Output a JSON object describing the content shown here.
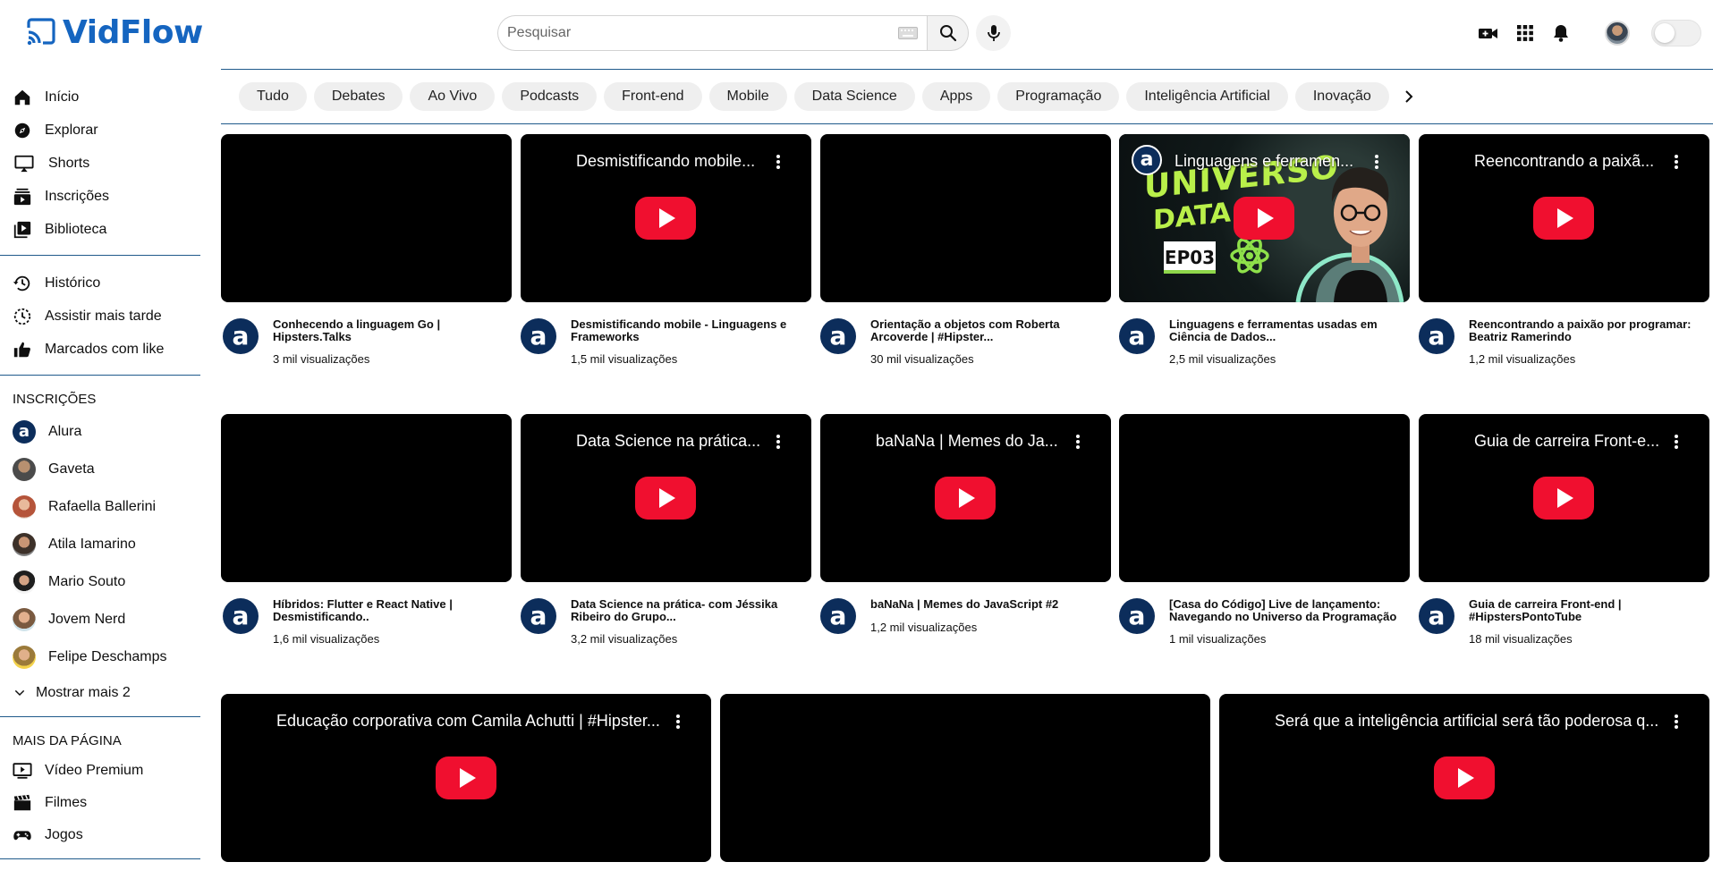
{
  "app": {
    "name": "VidFlow"
  },
  "search": {
    "placeholder": "Pesquisar"
  },
  "sidebar": {
    "main": [
      "Início",
      "Explorar",
      "Shorts",
      "Inscrições",
      "Biblioteca"
    ],
    "secondary": [
      "Histórico",
      "Assistir mais tarde",
      "Marcados com like"
    ],
    "subscriptions_title": "INSCRIÇÕES",
    "subscriptions": [
      "Alura",
      "Gaveta",
      "Rafaella Ballerini",
      "Atila Iamarino",
      "Mario Souto",
      "Jovem Nerd",
      "Felipe Deschamps"
    ],
    "show_more": "Mostrar mais 2",
    "more_title": "MAIS DA PÁGINA",
    "more": [
      "Vídeo Premium",
      "Filmes",
      "Jogos"
    ]
  },
  "chips": [
    "Tudo",
    "Debates",
    "Ao Vivo",
    "Podcasts",
    "Front-end",
    "Mobile",
    "Data Science",
    "Apps",
    "Programação",
    "Inteligência Artificial",
    "Inovação"
  ],
  "videos": [
    {
      "overlay_title": "",
      "title": "Conhecendo a linguagem Go | Hipsters.Talks",
      "views": "3 mil visualizações"
    },
    {
      "overlay_title": "Desmistificando mobile...",
      "title": "Desmistificando mobile - Linguagens e Frameworks",
      "views": "1,5 mil visualizações"
    },
    {
      "overlay_title": "",
      "title": "Orientação a objetos com Roberta Arcoverde | #Hipster...",
      "views": "30 mil visualizações"
    },
    {
      "overlay_title": "Linguagens e ferramen...",
      "title": "Linguagens e ferramentas usadas em Ciência de Dados...",
      "views": "2,5 mil visualizações",
      "thumb_text": [
        "UNIVERSO",
        "DATA SC",
        "EP03"
      ]
    },
    {
      "overlay_title": "Reencontrando a paixã...",
      "title": "Reencontrando a paixão por programar: Beatriz Ramerindo",
      "views": "1,2 mil visualizações"
    },
    {
      "overlay_title": "",
      "title": "Híbridos: Flutter e React Native | Desmistificando..",
      "views": "1,6 mil visualizações"
    },
    {
      "overlay_title": "Data Science na prática...",
      "title": "Data Science na prática- com Jéssika Ribeiro do Grupo...",
      "views": "3,2 mil visualizações"
    },
    {
      "overlay_title": "baNaNa | Memes do Ja...",
      "title": "baNaNa | Memes do JavaScript #2",
      "views": "1,2 mil visualizações"
    },
    {
      "overlay_title": "",
      "title": "[Casa do Código] Live de lançamento: Navegando no Universo da Programação",
      "views": "1 mil visualizações"
    },
    {
      "overlay_title": "Guia de carreira Front-e...",
      "title": "Guia de carreira Front-end | #HipstersPontoTube",
      "views": "18 mil visualizações"
    },
    {
      "overlay_title": "Educação corporativa com Camila Achutti | #Hipster...",
      "title": "",
      "views": ""
    },
    {
      "overlay_title": "",
      "title": "",
      "views": ""
    },
    {
      "overlay_title": "Será que a inteligência artificial será tão poderosa q...",
      "title": "",
      "views": ""
    }
  ],
  "colors": {
    "brand": "#1565c0",
    "play": "#f00f2f",
    "divider": "#1f5a8b",
    "channel": "#0c2d5b"
  }
}
